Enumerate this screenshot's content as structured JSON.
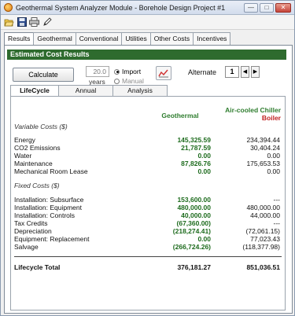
{
  "window": {
    "title": "Geothermal System Analyzer Module - Borehole Design Project #1"
  },
  "tabs": [
    "Results",
    "Geothermal",
    "Conventional",
    "Utilities",
    "Other Costs",
    "Incentives"
  ],
  "section_title": "Estimated Cost Results",
  "controls": {
    "calculate_label": "Calculate",
    "years_value": "20.0",
    "years_label": "years",
    "import_label": "Import",
    "manual_label": "Manual",
    "alternate_label": "Alternate",
    "alternate_value": "1"
  },
  "subtabs": [
    "LifeCycle",
    "Annual",
    "Analysis"
  ],
  "headers": {
    "geo": "Geothermal",
    "air": "Air-cooled Chiller",
    "boiler": "Boiler"
  },
  "variable_costs": {
    "label": "Variable Costs ($)",
    "rows": [
      {
        "label": "Energy",
        "geo": "145,325.59",
        "alt": "234,394.44"
      },
      {
        "label": "CO2 Emissions",
        "geo": "21,787.59",
        "alt": "30,404.24"
      },
      {
        "label": "Water",
        "geo": "0.00",
        "alt": "0.00"
      },
      {
        "label": "Maintenance",
        "geo": "87,826.76",
        "alt": "175,653.53"
      },
      {
        "label": "Mechanical Room Lease",
        "geo": "0.00",
        "alt": "0.00"
      }
    ]
  },
  "fixed_costs": {
    "label": "Fixed Costs ($)",
    "rows": [
      {
        "label": "Installation:  Subsurface",
        "geo": "153,600.00",
        "alt": "---"
      },
      {
        "label": "Installation:  Equipment",
        "geo": "480,000.00",
        "alt": "480,000.00"
      },
      {
        "label": "Installation:  Controls",
        "geo": "40,000.00",
        "alt": "44,000.00"
      },
      {
        "label": "Tax Credits",
        "geo": "(67,360.00)",
        "alt": "---"
      },
      {
        "label": "Depreciation",
        "geo": "(218,274.41)",
        "alt": "(72,061.15)"
      },
      {
        "label": "Equipment:  Replacement",
        "geo": "0.00",
        "alt": "77,023.43"
      },
      {
        "label": "Salvage",
        "geo": "(266,724.26)",
        "alt": "(118,377.98)"
      }
    ]
  },
  "total": {
    "label": "Lifecycle Total",
    "geo": "376,181.27",
    "alt": "851,036.51"
  },
  "icons": [
    "app-icon",
    "open-icon",
    "save-icon",
    "print-icon",
    "edit-icon",
    "chart-icon"
  ]
}
